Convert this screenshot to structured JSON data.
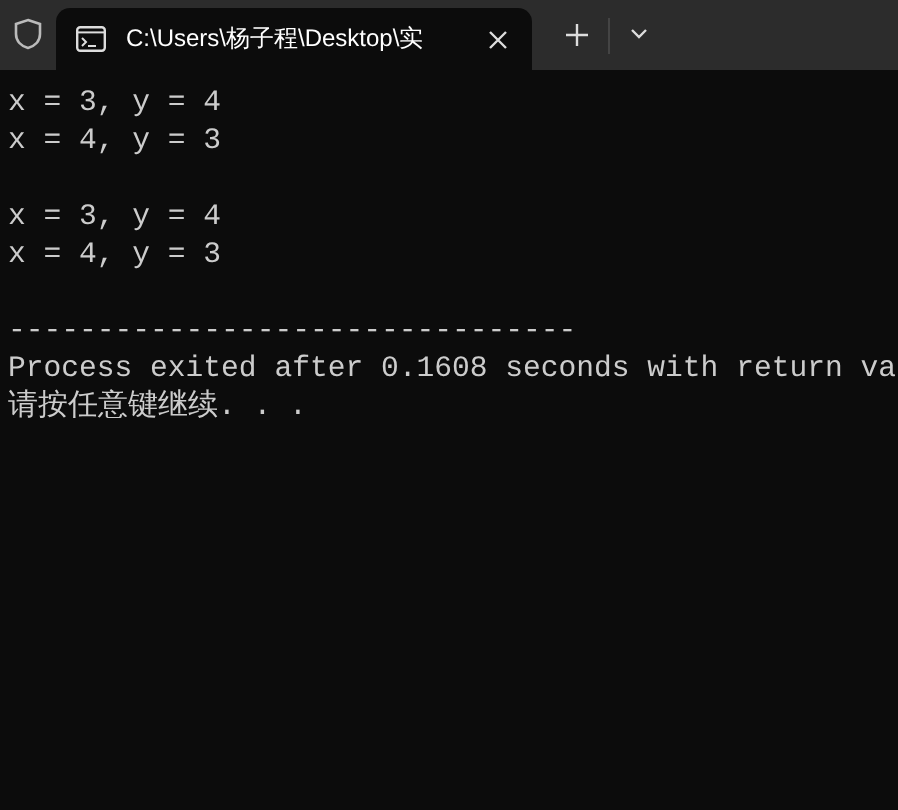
{
  "tab": {
    "title": "C:\\Users\\杨子程\\Desktop\\实"
  },
  "console": {
    "blocks": [
      [
        "x = 3, y = 4",
        "x = 4, y = 3"
      ],
      [
        "x = 3, y = 4",
        "x = 4, y = 3"
      ],
      [
        "--------------------------------",
        "Process exited after 0.1608 seconds with return va",
        "请按任意键继续. . ."
      ]
    ]
  }
}
